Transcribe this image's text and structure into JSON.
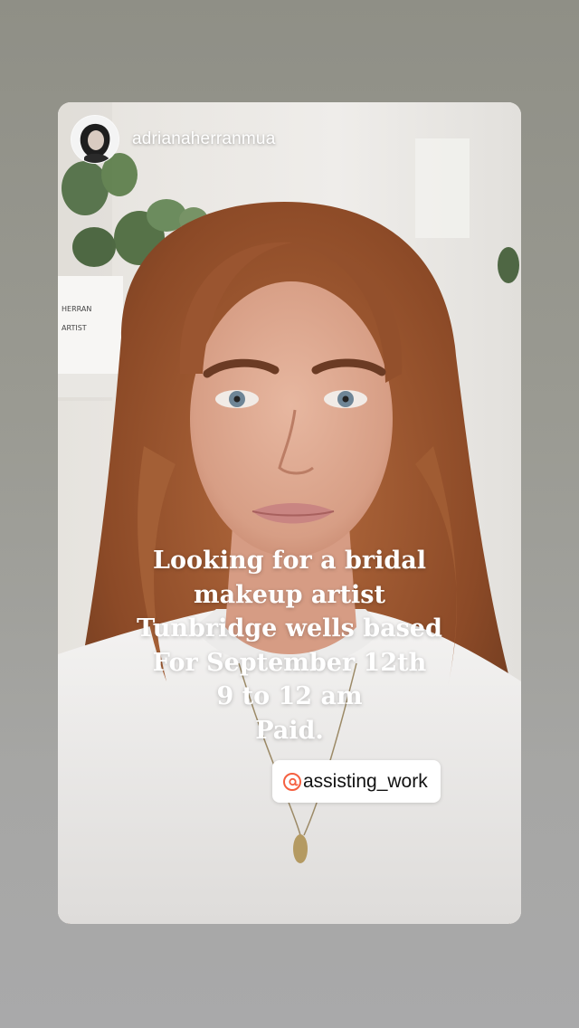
{
  "story": {
    "username": "adrianaherranmua",
    "caption_lines": [
      "Looking for a bridal",
      "makeup artist",
      "Tunbridge wells based",
      "For September 12th",
      "9 to 12 am",
      "Paid."
    ],
    "mention": {
      "handle": "assisting_work",
      "icon": "threads-icon"
    }
  },
  "colors": {
    "page_background": "#9a9a92",
    "caption_text": "#ffffff",
    "mention_background": "#ffffff",
    "mention_text": "#111111",
    "threads_accent": "#f56040"
  }
}
